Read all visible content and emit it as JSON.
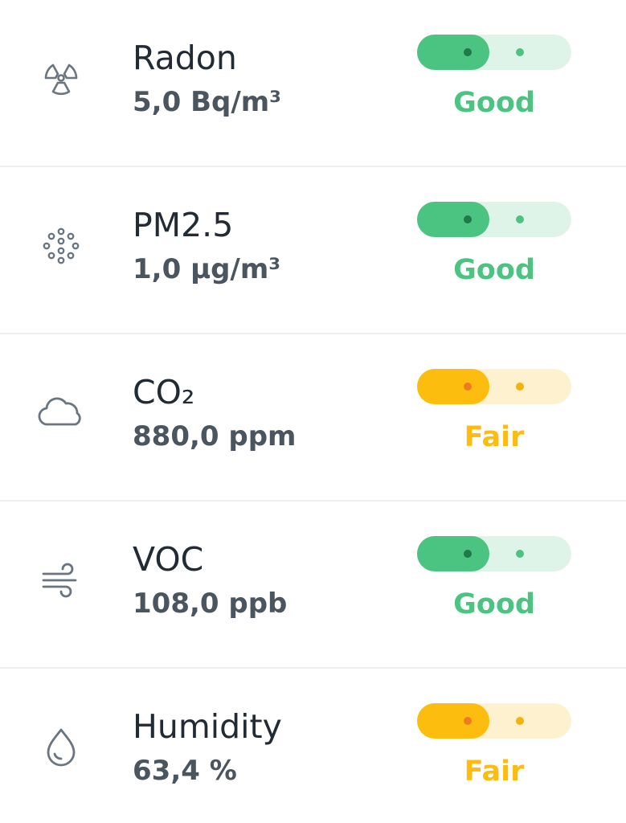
{
  "colors": {
    "good": "#4bc482",
    "good_track": "#dff4e8",
    "good_dot": "#1e7a48",
    "fair": "#fcbd0f",
    "fair_track": "#fdf1cf",
    "fair_dot": "#f07a22",
    "fair_dot_track": "#f5b20a",
    "icon": "#6b7580"
  },
  "sensors": [
    {
      "name": "Radon",
      "value": "5,0 Bq/m³",
      "status": "Good",
      "level": "good",
      "icon": "radiation-icon",
      "indicator_fill": 0.47
    },
    {
      "name": "PM2.5",
      "value": "1,0 µg/m³",
      "status": "Good",
      "level": "good",
      "icon": "particles-icon",
      "indicator_fill": 0.47
    },
    {
      "name": "CO₂",
      "value": "880,0 ppm",
      "status": "Fair",
      "level": "fair",
      "icon": "cloud-icon",
      "indicator_fill": 0.47
    },
    {
      "name": "VOC",
      "value": "108,0 ppb",
      "status": "Good",
      "level": "good",
      "icon": "wind-icon",
      "indicator_fill": 0.47
    },
    {
      "name": "Humidity",
      "value": "63,4 %",
      "status": "Fair",
      "level": "fair",
      "icon": "droplet-icon",
      "indicator_fill": 0.47
    }
  ]
}
